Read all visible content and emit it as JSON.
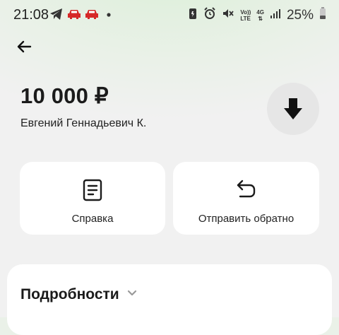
{
  "status_bar": {
    "time": "21:08",
    "battery": "25%",
    "network_top": "Vo))",
    "network_bottom": "LTE",
    "network_gen": "4G"
  },
  "payment": {
    "amount": "10 000 ₽",
    "payer": "Евгений Геннадьевич К."
  },
  "actions": {
    "receipt_label": "Справка",
    "return_label": "Отправить обратно"
  },
  "details": {
    "title": "Подробности"
  },
  "colors": {
    "accent_red": "#d62828",
    "card_bg": "#ffffff",
    "circle_bg": "#e6e6e6"
  }
}
